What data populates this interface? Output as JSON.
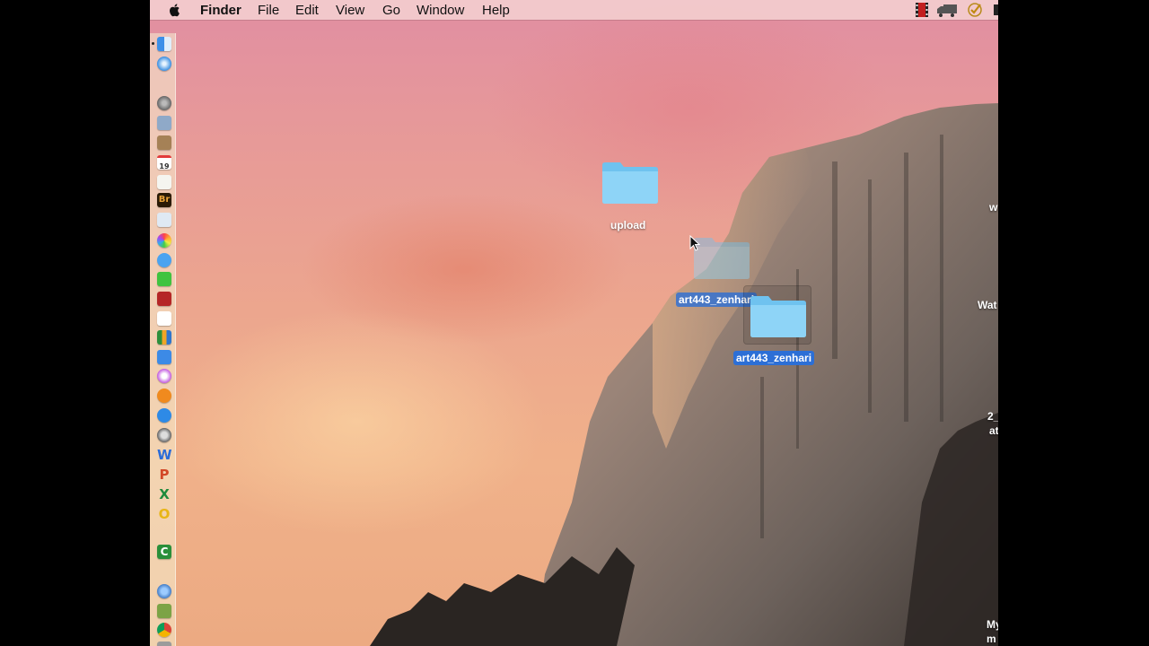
{
  "menubar": {
    "app_name": "Finder",
    "items": [
      "File",
      "Edit",
      "View",
      "Go",
      "Window",
      "Help"
    ],
    "apple_icon": "apple-icon",
    "status_icons": [
      "film-icon",
      "truck-icon",
      "checkmark-icon",
      "partial-icon"
    ]
  },
  "dock": {
    "icons": [
      "finder-icon",
      "safari-icon",
      "launchpad-icon",
      "mail-stamp-icon",
      "notes-book-icon",
      "calendar-icon",
      "textedit-icon",
      "bridge-icon",
      "preview-icon",
      "photos-icon",
      "messages-icon",
      "facetime-icon",
      "photo-booth-icon",
      "reminders-icon",
      "numbers-icon",
      "keynote-icon",
      "itunes-icon",
      "ibooks-icon",
      "app-store-icon",
      "system-preferences-icon",
      "word-icon",
      "powerpoint-icon",
      "excel-icon",
      "outlook-icon",
      "camtasia-icon",
      "network-icon",
      "archive-icon",
      "chrome-icon",
      "trash-icon"
    ],
    "calendar_day": "19",
    "bridge_text": "Br"
  },
  "desktop": {
    "folders": {
      "upload": "upload",
      "drag_ghost": "art443_zenhari",
      "selected": "art443_zenhari"
    },
    "edge_labels": [
      "w",
      "Wat",
      "2_",
      "at",
      "My",
      "m"
    ]
  },
  "colors": {
    "selection_blue": "#2c6fd6",
    "folder_blue": "#7dccf4",
    "menubar_tint": "#f4d2d2"
  }
}
